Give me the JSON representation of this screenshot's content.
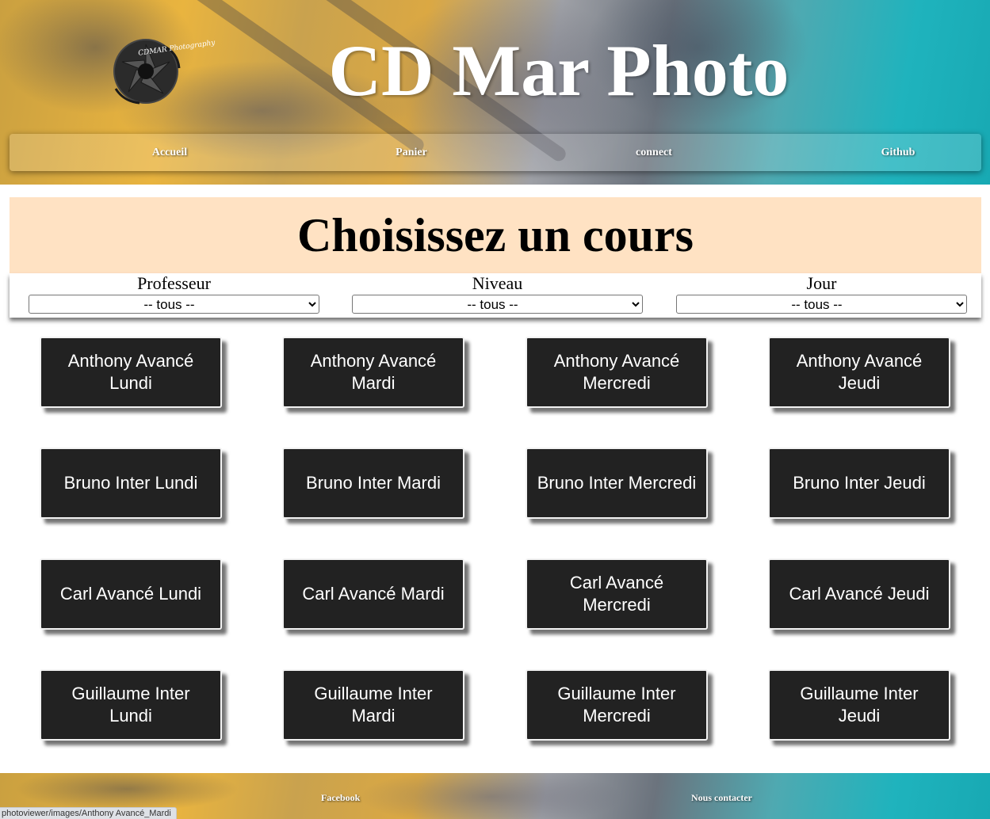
{
  "header": {
    "title": "CD Mar Photo",
    "logo_text": "CDMAR Photography",
    "nav": [
      {
        "label": "Accueil"
      },
      {
        "label": "Panier"
      },
      {
        "label": "connect"
      },
      {
        "label": "Github"
      }
    ]
  },
  "main": {
    "heading": "Choisissez un cours",
    "filters": [
      {
        "label": "Professeur",
        "selected": "-- tous --"
      },
      {
        "label": "Niveau",
        "selected": "-- tous --"
      },
      {
        "label": "Jour",
        "selected": "-- tous --"
      }
    ],
    "courses": [
      {
        "label": "Anthony Avancé Lundi"
      },
      {
        "label": "Anthony Avancé Mardi"
      },
      {
        "label": "Anthony Avancé Mercredi"
      },
      {
        "label": "Anthony Avancé Jeudi"
      },
      {
        "label": "Bruno Inter Lundi"
      },
      {
        "label": "Bruno Inter Mardi"
      },
      {
        "label": "Bruno Inter Mercredi"
      },
      {
        "label": "Bruno Inter Jeudi"
      },
      {
        "label": "Carl Avancé Lundi"
      },
      {
        "label": "Carl Avancé Mardi"
      },
      {
        "label": "Carl Avancé Mercredi"
      },
      {
        "label": "Carl Avancé Jeudi"
      },
      {
        "label": "Guillaume Inter Lundi"
      },
      {
        "label": "Guillaume Inter Mardi"
      },
      {
        "label": "Guillaume Inter Mercredi"
      },
      {
        "label": "Guillaume Inter Jeudi"
      }
    ]
  },
  "footer": {
    "links": [
      {
        "label": "Facebook"
      },
      {
        "label": "Nous contacter"
      }
    ]
  },
  "status_bar": {
    "url": "photoviewer/images/Anthony Avancé_Mardi"
  },
  "colors": {
    "heading_bg": "#ffe2c3",
    "course_bg": "#222222",
    "header_teal": "#1fb3bd",
    "header_ochre": "#e9b43f"
  }
}
